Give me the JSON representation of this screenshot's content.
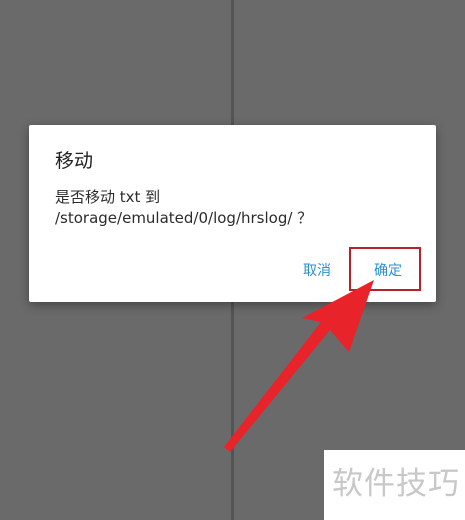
{
  "dialog": {
    "title": "移动",
    "message_line1": "是否移动 txt 到",
    "message_line2": "/storage/emulated/0/log/hrslog/ ？",
    "cancel_label": "取消",
    "confirm_label": "确定"
  },
  "watermark": {
    "text": "软件技巧"
  },
  "colors": {
    "accent": "#2a8fd0",
    "annotation": "#e8232a",
    "highlight_border": "#b8202a",
    "scrim": "#6a6a6a"
  }
}
